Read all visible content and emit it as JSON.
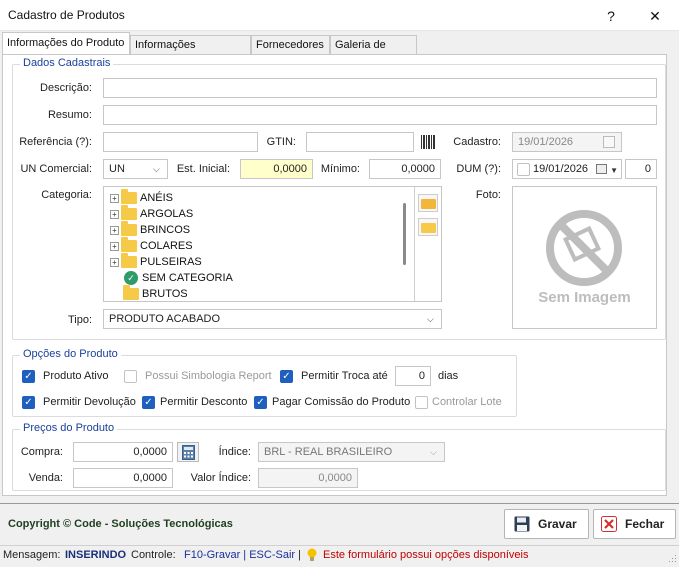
{
  "window": {
    "title": "Cadastro de Produtos",
    "help_label": "?",
    "close_label": "✕"
  },
  "tabs": [
    {
      "label": "Informações do Produto",
      "active": true
    },
    {
      "label": "Informações Adicionais",
      "active": false
    },
    {
      "label": "Fornecedores",
      "active": false
    },
    {
      "label": "Galeria de Fotos",
      "active": false
    }
  ],
  "dados": {
    "group_title": "Dados Cadastrais",
    "descricao_label": "Descrição:",
    "descricao_value": "",
    "resumo_label": "Resumo:",
    "resumo_value": "",
    "referencia_label": "Referência (?):",
    "referencia_value": "",
    "gtin_label": "GTIN:",
    "gtin_value": "",
    "cadastro_label": "Cadastro:",
    "cadastro_value": "19/01/2026",
    "un_label": "UN Comercial:",
    "un_value": "UN",
    "est_inicial_label": "Est. Inicial:",
    "est_inicial_value": "0,0000",
    "minimo_label": "Mínimo:",
    "minimo_value": "0,0000",
    "dum_label": "DUM (?):",
    "dum_value": "19/01/2026",
    "dum_days": "0",
    "categoria_label": "Categoria:",
    "categorias": [
      {
        "label": "ANÉIS",
        "expandable": true,
        "icon": "folder-icon"
      },
      {
        "label": "ARGOLAS",
        "expandable": true,
        "icon": "folder-icon"
      },
      {
        "label": "BRINCOS",
        "expandable": true,
        "icon": "folder-icon"
      },
      {
        "label": "COLARES",
        "expandable": true,
        "icon": "folder-icon"
      },
      {
        "label": "PULSEIRAS",
        "expandable": true,
        "icon": "folder-icon"
      },
      {
        "label": "SEM CATEGORIA",
        "expandable": false,
        "icon": "check-circle-icon"
      },
      {
        "label": "BRUTOS",
        "expandable": false,
        "icon": "folder-icon"
      }
    ],
    "foto_label": "Foto:",
    "sem_imagem_label": "Sem Imagem",
    "tipo_label": "Tipo:",
    "tipo_value": "PRODUTO ACABADO"
  },
  "opcoes": {
    "group_title": "Opções do Produto",
    "produto_ativo": {
      "label": "Produto Ativo",
      "checked": true,
      "enabled": true
    },
    "simbologia": {
      "label": "Possui Simbologia Report",
      "checked": false,
      "enabled": false
    },
    "permitir_troca": {
      "label": "Permitir Troca até",
      "checked": true,
      "enabled": true
    },
    "troca_dias_value": "0",
    "dias_label": "dias",
    "permitir_devolucao": {
      "label": "Permitir Devolução",
      "checked": true,
      "enabled": true
    },
    "permitir_desconto": {
      "label": "Permitir Desconto",
      "checked": true,
      "enabled": true
    },
    "pagar_comissao": {
      "label": "Pagar Comissão do Produto",
      "checked": true,
      "enabled": true
    },
    "controlar_lote": {
      "label": "Controlar Lote",
      "checked": false,
      "enabled": false
    }
  },
  "precos": {
    "group_title": "Preços do Produto",
    "compra_label": "Compra:",
    "compra_value": "0,0000",
    "indice_label": "Índice:",
    "indice_value": "BRL - REAL BRASILEIRO",
    "venda_label": "Venda:",
    "venda_value": "0,0000",
    "valor_indice_label": "Valor Índice:",
    "valor_indice_value": "0,0000"
  },
  "footer": {
    "copyright": "Copyright © Code - Soluções Tecnológicas",
    "gravar_label": "Gravar",
    "fechar_label": "Fechar"
  },
  "status": {
    "mensagem_label": "Mensagem:",
    "mensagem_value": "INSERINDO",
    "controle_label": "Controle:",
    "controle_value": "F10-Gravar | ESC-Sair",
    "separator": "|",
    "info_text": "Este formulário possui opções disponíveis"
  },
  "colors": {
    "accent_blue": "#1f5fbf",
    "group_title_blue": "#1a3f9a",
    "footer_green": "#1f3f1f",
    "status_red": "#c00000",
    "fechar_icon_red": "#d32f2f"
  }
}
